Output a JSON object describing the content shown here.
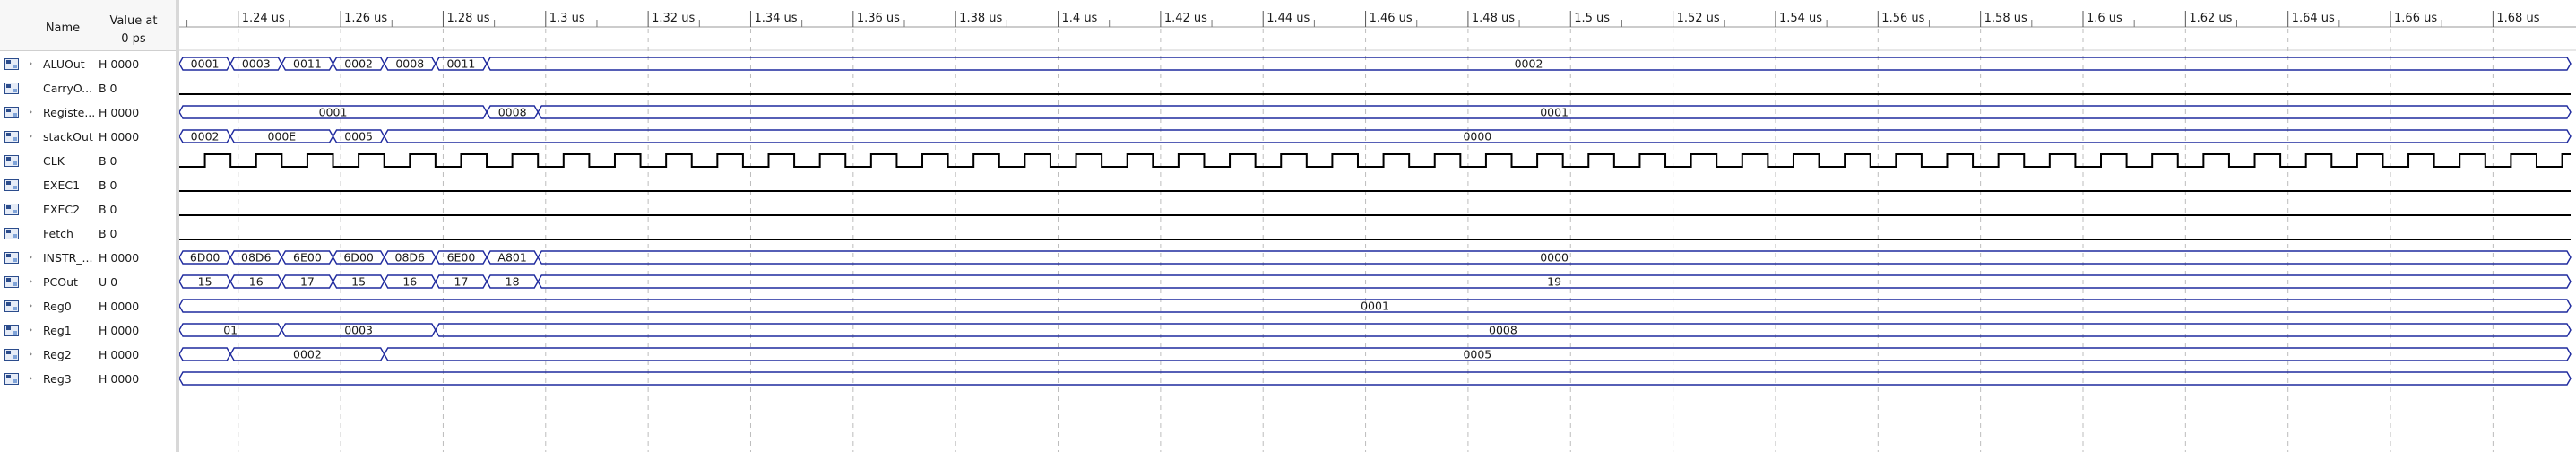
{
  "header": {
    "name_label": "Name",
    "value_label_line1": "Value at",
    "value_label_line2": "0 ps"
  },
  "colors": {
    "wave": "#1f2a9e",
    "clock": "#000000",
    "grid": "#bdbdbd",
    "line": "#1f2a9e"
  },
  "time_axis": {
    "start_us": 1.2285,
    "end_us": 1.6955,
    "ticks": [
      {
        "t": 1.24,
        "label": "1.24 us"
      },
      {
        "t": 1.26,
        "label": "1.26 us"
      },
      {
        "t": 1.28,
        "label": "1.28 us"
      },
      {
        "t": 1.3,
        "label": "1.3 us"
      },
      {
        "t": 1.32,
        "label": "1.32 us"
      },
      {
        "t": 1.34,
        "label": "1.34 us"
      },
      {
        "t": 1.36,
        "label": "1.36 us"
      },
      {
        "t": 1.38,
        "label": "1.38 us"
      },
      {
        "t": 1.4,
        "label": "1.4 us"
      },
      {
        "t": 1.42,
        "label": "1.42 us"
      },
      {
        "t": 1.44,
        "label": "1.44 us"
      },
      {
        "t": 1.46,
        "label": "1.46 us"
      },
      {
        "t": 1.48,
        "label": "1.48 us"
      },
      {
        "t": 1.5,
        "label": "1.5 us"
      },
      {
        "t": 1.52,
        "label": "1.52 us"
      },
      {
        "t": 1.54,
        "label": "1.54 us"
      },
      {
        "t": 1.56,
        "label": "1.56 us"
      },
      {
        "t": 1.58,
        "label": "1.58 us"
      },
      {
        "t": 1.6,
        "label": "1.6 us"
      },
      {
        "t": 1.62,
        "label": "1.62 us"
      },
      {
        "t": 1.64,
        "label": "1.64 us"
      },
      {
        "t": 1.66,
        "label": "1.66 us"
      },
      {
        "t": 1.68,
        "label": "1.68 us"
      }
    ]
  },
  "signals": [
    {
      "name": "ALUOut",
      "value": "H 0000",
      "kind": "bus",
      "expandable": true,
      "transitions": [
        1.2285,
        1.2385,
        1.2485,
        1.2585,
        1.2685,
        1.2785,
        1.2885
      ],
      "labels": [
        "0001",
        "0003",
        "0011",
        "0002",
        "0008",
        "0011",
        "0002"
      ]
    },
    {
      "name": "CarryO...",
      "value": "B 0",
      "kind": "bit",
      "expandable": false,
      "level": 0
    },
    {
      "name": "Registe...",
      "value": "H 0000",
      "kind": "bus",
      "expandable": true,
      "transitions": [
        1.2285,
        1.2885,
        1.2985
      ],
      "labels": [
        "0001",
        "0008",
        "0001"
      ]
    },
    {
      "name": "stackOut",
      "value": "H 0000",
      "kind": "bus",
      "expandable": true,
      "transitions": [
        1.2285,
        1.2385,
        1.2585,
        1.2685
      ],
      "labels": [
        "0002",
        "000E",
        "0005",
        "0000"
      ]
    },
    {
      "name": "CLK",
      "value": "B 0",
      "kind": "clock",
      "expandable": false,
      "period": 0.01,
      "first_rise": 1.2335
    },
    {
      "name": "EXEC1",
      "value": "B 0",
      "kind": "bit",
      "expandable": false,
      "level": 0
    },
    {
      "name": "EXEC2",
      "value": "B 0",
      "kind": "bit",
      "expandable": false,
      "level": 0
    },
    {
      "name": "Fetch",
      "value": "B 0",
      "kind": "bit",
      "expandable": false,
      "level": 0
    },
    {
      "name": "INSTR_...",
      "value": "H 0000",
      "kind": "bus",
      "expandable": true,
      "transitions": [
        1.2285,
        1.2385,
        1.2485,
        1.2585,
        1.2685,
        1.2785,
        1.2885,
        1.2985
      ],
      "labels": [
        "6D00",
        "08D6",
        "6E00",
        "6D00",
        "08D6",
        "6E00",
        "A801",
        "0000"
      ]
    },
    {
      "name": "PCOut",
      "value": "U 0",
      "kind": "bus",
      "expandable": true,
      "transitions": [
        1.2285,
        1.2385,
        1.2485,
        1.2585,
        1.2685,
        1.2785,
        1.2885,
        1.2985
      ],
      "labels": [
        "15",
        "16",
        "17",
        "15",
        "16",
        "17",
        "18",
        "19"
      ]
    },
    {
      "name": "Reg0",
      "value": "H 0000",
      "kind": "bus",
      "expandable": true,
      "transitions": [
        1.2285
      ],
      "labels": [
        "0001"
      ]
    },
    {
      "name": "Reg1",
      "value": "H 0000",
      "kind": "bus",
      "expandable": true,
      "transitions": [
        1.2285,
        1.2485,
        1.2785
      ],
      "labels": [
        "01",
        "0003",
        "0008"
      ]
    },
    {
      "name": "Reg2",
      "value": "H 0000",
      "kind": "bus",
      "expandable": true,
      "transitions": [
        1.2285,
        1.2385,
        1.2685
      ],
      "labels": [
        "",
        "0002",
        "0005"
      ]
    },
    {
      "name": "Reg3",
      "value": "H 0000",
      "kind": "bus",
      "expandable": true,
      "transitions": [
        1.2285
      ],
      "labels": [
        ""
      ]
    }
  ]
}
